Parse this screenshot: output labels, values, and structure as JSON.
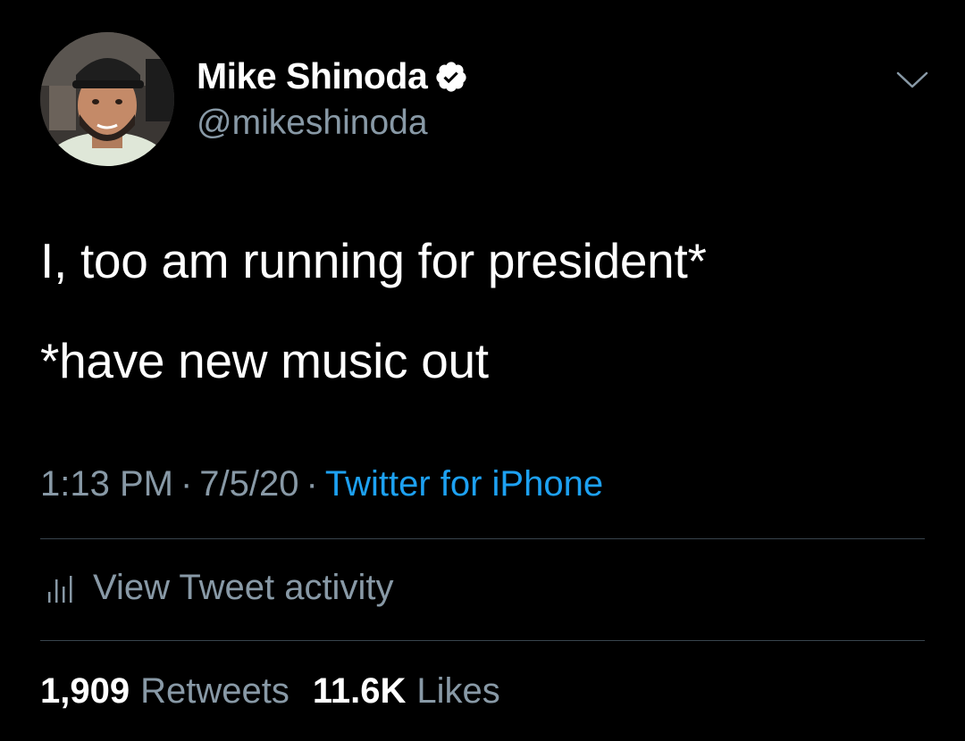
{
  "author": {
    "name": "Mike Shinoda",
    "handle": "@mikeshinoda",
    "verified": true
  },
  "tweet": {
    "line1": "I, too am running for president*",
    "line2": "*have new music out"
  },
  "meta": {
    "time": "1:13 PM",
    "separator": "·",
    "date": "7/5/20",
    "source": "Twitter for iPhone"
  },
  "activity": {
    "label": "View Tweet activity"
  },
  "stats": {
    "retweets_count": "1,909",
    "retweets_label": "Retweets",
    "likes_count": "11.6K",
    "likes_label": "Likes"
  },
  "icons": {
    "verified": "verified-badge-icon",
    "caret": "chevron-down-icon",
    "activity": "bar-chart-icon"
  },
  "colors": {
    "background": "#000000",
    "primary_text": "#ffffff",
    "secondary_text": "#8899a6",
    "link": "#1da1f2",
    "divider": "#38444d"
  }
}
